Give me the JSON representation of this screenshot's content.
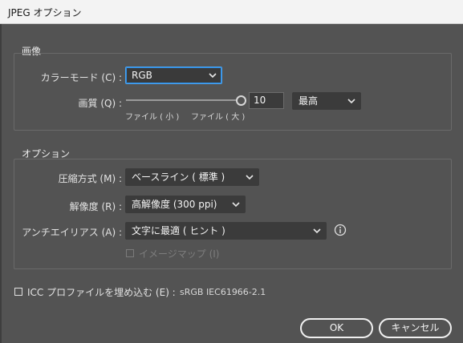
{
  "window": {
    "title": "JPEG オプション"
  },
  "image_group": {
    "title": "画像",
    "color_mode_label": "カラーモード (C) :",
    "color_mode_value": "RGB",
    "quality_label": "画質 (Q) :",
    "quality_value": "10",
    "quality_max": "12",
    "quality_preset": "最高",
    "slider_min_label": "ファイル ( 小 )",
    "slider_max_label": "ファイル ( 大 )"
  },
  "options_group": {
    "title": "オプション",
    "compression_label": "圧縮方式 (M) :",
    "compression_value": "ベースライン ( 標準 )",
    "resolution_label": "解像度 (R) :",
    "resolution_value": "高解像度 (300 ppi)",
    "antialias_label": "アンチエイリアス (A) :",
    "antialias_value": "文字に最適 ( ヒント )",
    "imagemap_label": "イメージマップ (I)"
  },
  "icc": {
    "label": "ICC プロファイルを埋め込む (E) :",
    "profile": "sRGB IEC61966-2.1"
  },
  "buttons": {
    "ok": "OK",
    "cancel": "キャンセル"
  },
  "colors": {
    "background": "#535353",
    "focus": "#2d8ce3",
    "field": "#3b3b3b"
  }
}
